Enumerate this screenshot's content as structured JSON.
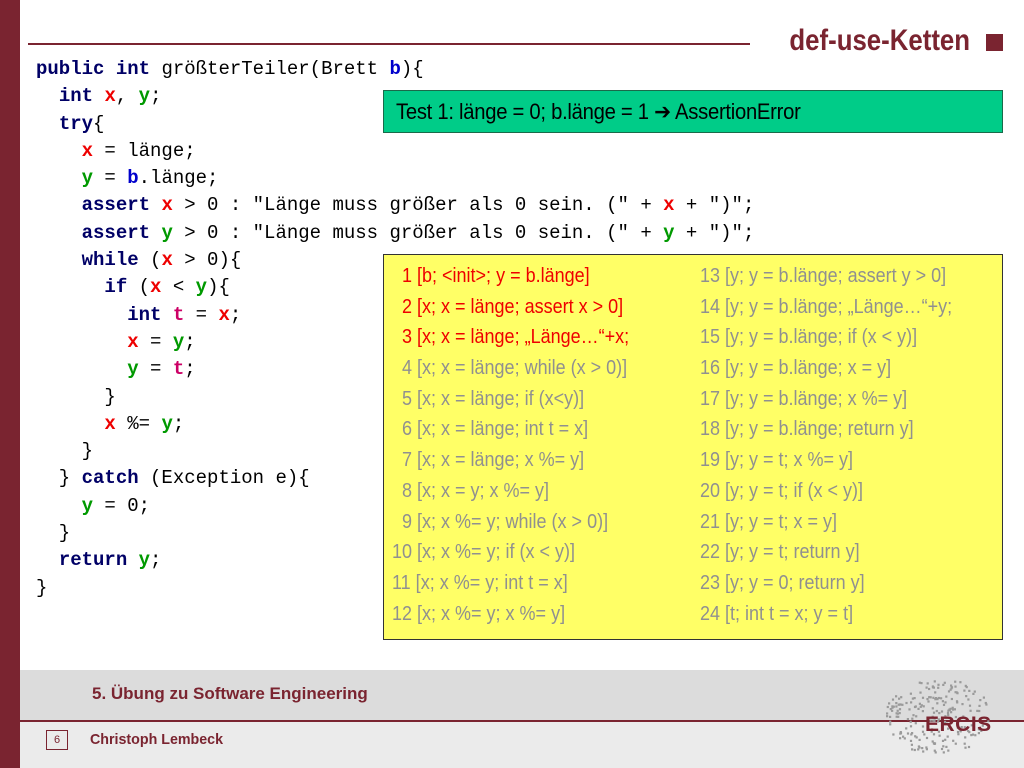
{
  "slide": {
    "title": "def-use-Ketten",
    "page_number": "6",
    "course": "5. Übung zu Software Engineering",
    "author": "Christoph Lembeck",
    "logo_text": "ERCIS"
  },
  "colors": {
    "accent": "#7a2430",
    "test_box": "#00cc88",
    "chain_box": "#ffff66",
    "active_chain": "#ee0000",
    "inactive_chain": "#909090"
  },
  "code_lines": [
    [
      {
        "t": "public",
        "c": "kw"
      },
      {
        "t": " "
      },
      {
        "t": "int",
        "c": "kw"
      },
      {
        "t": " größterTeiler(Brett "
      },
      {
        "t": "b",
        "c": "vb"
      },
      {
        "t": "){"
      }
    ],
    [
      {
        "t": "  "
      },
      {
        "t": "int",
        "c": "kw"
      },
      {
        "t": " "
      },
      {
        "t": "x",
        "c": "vx"
      },
      {
        "t": ", "
      },
      {
        "t": "y",
        "c": "vy"
      },
      {
        "t": ";"
      }
    ],
    [
      {
        "t": "  "
      },
      {
        "t": "try",
        "c": "kw"
      },
      {
        "t": "{"
      }
    ],
    [
      {
        "t": "    "
      },
      {
        "t": "x",
        "c": "vx"
      },
      {
        "t": " = länge;"
      }
    ],
    [
      {
        "t": "    "
      },
      {
        "t": "y",
        "c": "vy"
      },
      {
        "t": " = "
      },
      {
        "t": "b",
        "c": "vb"
      },
      {
        "t": ".länge;"
      }
    ],
    [
      {
        "t": "    "
      },
      {
        "t": "assert",
        "c": "kw"
      },
      {
        "t": " "
      },
      {
        "t": "x",
        "c": "vx"
      },
      {
        "t": " > 0 : \"Länge muss größer als 0 sein. (\" + "
      },
      {
        "t": "x",
        "c": "vx"
      },
      {
        "t": " + \")\";"
      }
    ],
    [
      {
        "t": "    "
      },
      {
        "t": "assert",
        "c": "kw"
      },
      {
        "t": " "
      },
      {
        "t": "y",
        "c": "vy"
      },
      {
        "t": " > 0 : \"Länge muss größer als 0 sein. (\" + "
      },
      {
        "t": "y",
        "c": "vy"
      },
      {
        "t": " + \")\";"
      }
    ],
    [
      {
        "t": "    "
      },
      {
        "t": "while",
        "c": "kw"
      },
      {
        "t": " ("
      },
      {
        "t": "x",
        "c": "vx"
      },
      {
        "t": " > 0){"
      }
    ],
    [
      {
        "t": "      "
      },
      {
        "t": "if",
        "c": "kw"
      },
      {
        "t": " ("
      },
      {
        "t": "x",
        "c": "vx"
      },
      {
        "t": " < "
      },
      {
        "t": "y",
        "c": "vy"
      },
      {
        "t": "){"
      }
    ],
    [
      {
        "t": "        "
      },
      {
        "t": "int",
        "c": "kw"
      },
      {
        "t": " "
      },
      {
        "t": "t",
        "c": "vt"
      },
      {
        "t": " = "
      },
      {
        "t": "x",
        "c": "vx"
      },
      {
        "t": ";"
      }
    ],
    [
      {
        "t": "        "
      },
      {
        "t": "x",
        "c": "vx"
      },
      {
        "t": " = "
      },
      {
        "t": "y",
        "c": "vy"
      },
      {
        "t": ";"
      }
    ],
    [
      {
        "t": "        "
      },
      {
        "t": "y",
        "c": "vy"
      },
      {
        "t": " = "
      },
      {
        "t": "t",
        "c": "vt"
      },
      {
        "t": ";"
      }
    ],
    [
      {
        "t": "      }"
      }
    ],
    [
      {
        "t": "      "
      },
      {
        "t": "x",
        "c": "vx"
      },
      {
        "t": " %= "
      },
      {
        "t": "y",
        "c": "vy"
      },
      {
        "t": ";"
      }
    ],
    [
      {
        "t": "    }"
      }
    ],
    [
      {
        "t": "  } "
      },
      {
        "t": "catch",
        "c": "kw"
      },
      {
        "t": " (Exception e){"
      }
    ],
    [
      {
        "t": "    "
      },
      {
        "t": "y",
        "c": "vy"
      },
      {
        "t": " = 0;"
      }
    ],
    [
      {
        "t": "  }"
      }
    ],
    [
      {
        "t": "  "
      },
      {
        "t": "return",
        "c": "kw"
      },
      {
        "t": " "
      },
      {
        "t": "y",
        "c": "vy"
      },
      {
        "t": ";"
      }
    ],
    [
      {
        "t": "}"
      }
    ]
  ],
  "test": {
    "text": "Test 1: länge = 0; b.länge = 1 ➔ AssertionError"
  },
  "chains_left": [
    {
      "text": "  1 [b; <init>; y = b.länge]",
      "active": true
    },
    {
      "text": "  2 [x; x = länge; assert x > 0]",
      "active": true
    },
    {
      "text": "  3 [x; x = länge; „Länge…“+x;",
      "active": true
    },
    {
      "text": "  4 [x; x = länge; while (x > 0)]",
      "active": false
    },
    {
      "text": "  5 [x; x = länge; if (x<y)]",
      "active": false
    },
    {
      "text": "  6 [x; x = länge; int t = x]",
      "active": false
    },
    {
      "text": "  7 [x; x = länge; x %= y]",
      "active": false
    },
    {
      "text": "  8 [x; x = y; x %= y]",
      "active": false
    },
    {
      "text": "  9 [x; x %= y; while (x > 0)]",
      "active": false
    },
    {
      "text": "10 [x; x %= y; if (x < y)]",
      "active": false
    },
    {
      "text": "11 [x; x %= y; int t = x]",
      "active": false
    },
    {
      "text": "12 [x; x %= y; x %= y]",
      "active": false
    }
  ],
  "chains_right": [
    {
      "text": "13 [y; y = b.länge; assert y > 0]",
      "active": false
    },
    {
      "text": "14 [y; y = b.länge; „Länge…“+y;",
      "active": false
    },
    {
      "text": "15 [y; y = b.länge; if (x < y)]",
      "active": false
    },
    {
      "text": "16 [y; y = b.länge; x = y]",
      "active": false
    },
    {
      "text": "17 [y; y = b.länge; x %= y]",
      "active": false
    },
    {
      "text": "18 [y; y = b.länge; return y]",
      "active": false
    },
    {
      "text": "19 [y; y = t; x %= y]",
      "active": false
    },
    {
      "text": "20 [y; y = t; if (x < y)]",
      "active": false
    },
    {
      "text": "21 [y; y = t; x = y]",
      "active": false
    },
    {
      "text": "22 [y; y = t; return y]",
      "active": false
    },
    {
      "text": "23 [y; y = 0; return y]",
      "active": false
    },
    {
      "text": "24 [t; int t = x; y = t]",
      "active": false
    }
  ]
}
